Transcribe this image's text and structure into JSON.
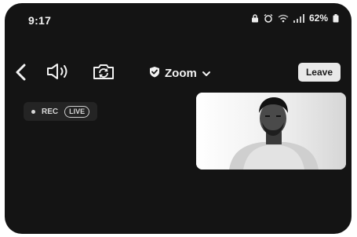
{
  "status_bar": {
    "time": "9:17",
    "battery": "62%",
    "icons": [
      "lock-icon",
      "alarm-icon",
      "wifi-icon",
      "signal-icon",
      "battery-icon"
    ]
  },
  "toolbar": {
    "back_icon": "chevron-left-icon",
    "speaker_icon": "speaker-icon",
    "camera_switch_icon": "camera-switch-icon",
    "meeting_title": "Zoom",
    "meeting_icon": "shield-check-icon",
    "meeting_dropdown_icon": "chevron-down-icon",
    "leave_label": "Leave"
  },
  "recording": {
    "rec_label": "REC",
    "live_label": "LIVE"
  },
  "self_view": {
    "label": "participant video"
  },
  "colors": {
    "background": "#141414",
    "text": "#f2f2f2",
    "leave_button_bg": "#e9e9e9",
    "leave_button_text": "#1a1a1a",
    "pill_bg": "#242424"
  }
}
